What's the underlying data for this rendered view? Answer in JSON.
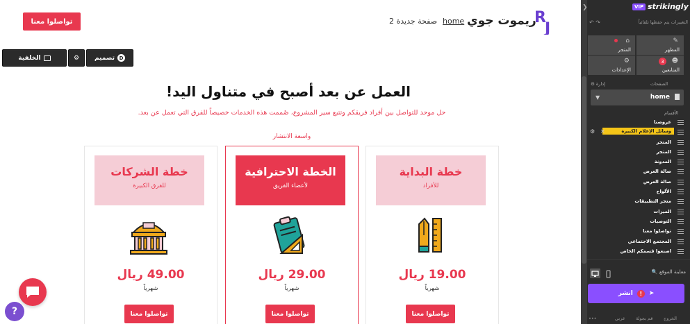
{
  "site": {
    "header_cta": "تواصلوا معنا",
    "logo_letters": "RJ",
    "brand": "ريموت جوي",
    "nav": {
      "home": "home",
      "page2": "صفحة جديدة 2"
    }
  },
  "editbar": {
    "background_label": "الخلفية",
    "design_label": "تصميم",
    "design_badge": "D"
  },
  "pricing": {
    "title": "العمل عن بعد أصبح في متناول اليد!",
    "subtitle": "حل موحد للتواصل بين أفراد فريقكم وتتبع سير المشروع، صُممت هذه الخدمات خصيصاً للفرق التي تعمل عن بعد.",
    "popular_label": "واسعة الانتشار",
    "plans": [
      {
        "title": "خطة الشركات",
        "subtitle": "للفرق الكبيرة",
        "price": "49.00 ريال",
        "period": "شهرياً",
        "button": "تواصلوا معنا",
        "icon": "building-icon"
      },
      {
        "title": "الخطة الاحترافية",
        "subtitle": "لأعضاء الفريق",
        "price": "29.00 ريال",
        "period": "شهرياً",
        "button": "تواصلوا معنا",
        "icon": "clipboard-icon"
      },
      {
        "title": "خطة البداية",
        "subtitle": "للأفراد",
        "price": "19.00 ريال",
        "period": "شهرياً",
        "button": "تواصلوا معنا",
        "icon": "pen-ruler-icon"
      }
    ]
  },
  "widgets": {
    "help": "?"
  },
  "sidebar": {
    "vip": "VIP",
    "logo": "strikingly",
    "autosave": "التغييرات يتم حفظها تلقائياً",
    "tiles": {
      "appearance": "المظهر",
      "store": "المتجر",
      "followers": "المتابعين",
      "followers_count": "3",
      "settings": "الإعدادات"
    },
    "pages_label": "الصفحات",
    "manage_label": "إدارة",
    "current_page": "home",
    "sections_label": "الأقسام",
    "sections": [
      "عروضنا",
      "وسائل الإعلام الكبيرة",
      "المتجر",
      "المتجر",
      "المدونة",
      "صالة العرض",
      "صالة العرض",
      "الألواح",
      "متجر التطبيقات",
      "الميزات",
      "التوصيات",
      "تواصلوا معنا",
      "المجتمع الاجتماعي",
      "اصنعوا قسمكم الخاص"
    ],
    "active_section_index": 1,
    "preview_label": "معاينة الموقع",
    "publish_label": "انشر",
    "publish_warning": "!",
    "footer": {
      "exit": "الخروج",
      "new_site": "قم بجولة",
      "lang": "عربي",
      "more": "•••"
    }
  },
  "colors": {
    "accent": "#e8384f",
    "accent_light": "#f5cdd6",
    "brand_purple": "#8a4fff",
    "highlight": "#f5c518",
    "icon_gold": "#f0a91c",
    "icon_teal": "#1fa39a"
  }
}
